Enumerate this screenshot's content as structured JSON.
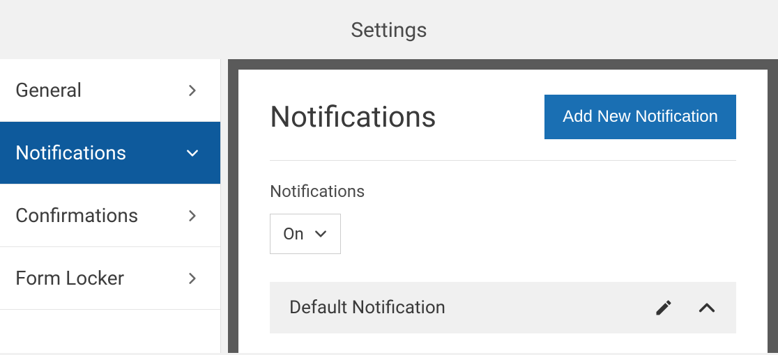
{
  "header": {
    "title": "Settings"
  },
  "sidebar": {
    "items": [
      {
        "label": "General"
      },
      {
        "label": "Notifications"
      },
      {
        "label": "Confirmations"
      },
      {
        "label": "Form Locker"
      }
    ]
  },
  "main": {
    "title": "Notifications",
    "add_button": "Add New Notification",
    "toggle_label": "Notifications",
    "toggle_value": "On",
    "default_item": "Default Notification"
  }
}
